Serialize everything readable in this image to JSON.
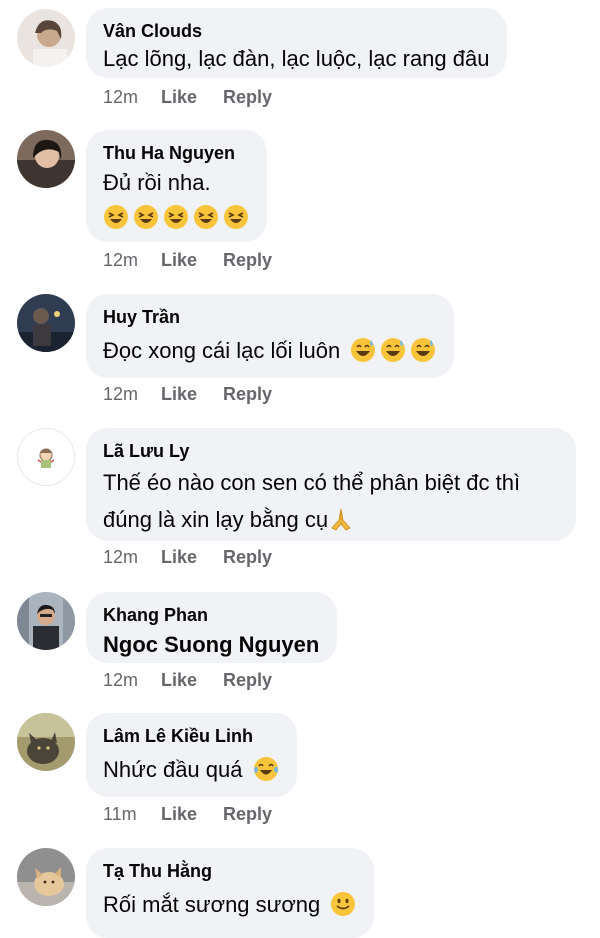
{
  "comments": [
    {
      "author": "Vân Clouds",
      "text": "Lạc lõng, lạc đàn, lạc luộc, lạc rang đâu",
      "time": "12m",
      "like": "Like",
      "reply": "Reply",
      "emojis": []
    },
    {
      "author": "Thu Ha Nguyen",
      "text": "Đủ rồi nha.",
      "time": "12m",
      "like": "Like",
      "reply": "Reply",
      "emojis": [
        "laughing-squint",
        "laughing-squint",
        "laughing-squint",
        "laughing-squint",
        "laughing-squint"
      ]
    },
    {
      "author": "Huy Trần",
      "text": "Đọc xong cái lạc lối luôn",
      "time": "12m",
      "like": "Like",
      "reply": "Reply",
      "emojis": [
        "grinning-sweat",
        "grinning-sweat",
        "grinning-sweat"
      ]
    },
    {
      "author": "Lã Lưu Ly",
      "text_line1": "Thế éo  nào con sen có thể phân biệt đc thì",
      "text_line2": "đúng là xin lạy bằng cụ",
      "time": "12m",
      "like": "Like",
      "reply": "Reply",
      "emojis": [
        "folded-hands"
      ]
    },
    {
      "author": "Khang Phan",
      "text": "Ngoc Suong Nguyen",
      "time": "12m",
      "like": "Like",
      "reply": "Reply",
      "emojis": []
    },
    {
      "author": "Lâm Lê Kiều Linh",
      "text": "Nhức đầu quá",
      "time": "11m",
      "like": "Like",
      "reply": "Reply",
      "emojis": [
        "tears-of-joy"
      ]
    },
    {
      "author": "Tạ Thu Hằng",
      "text": "Rối mắt sương sương",
      "emojis": [
        "slightly-smiling"
      ]
    }
  ],
  "colors": {
    "bubble": "#f0f2f5",
    "meta_text": "#65676b",
    "text": "#050505"
  }
}
